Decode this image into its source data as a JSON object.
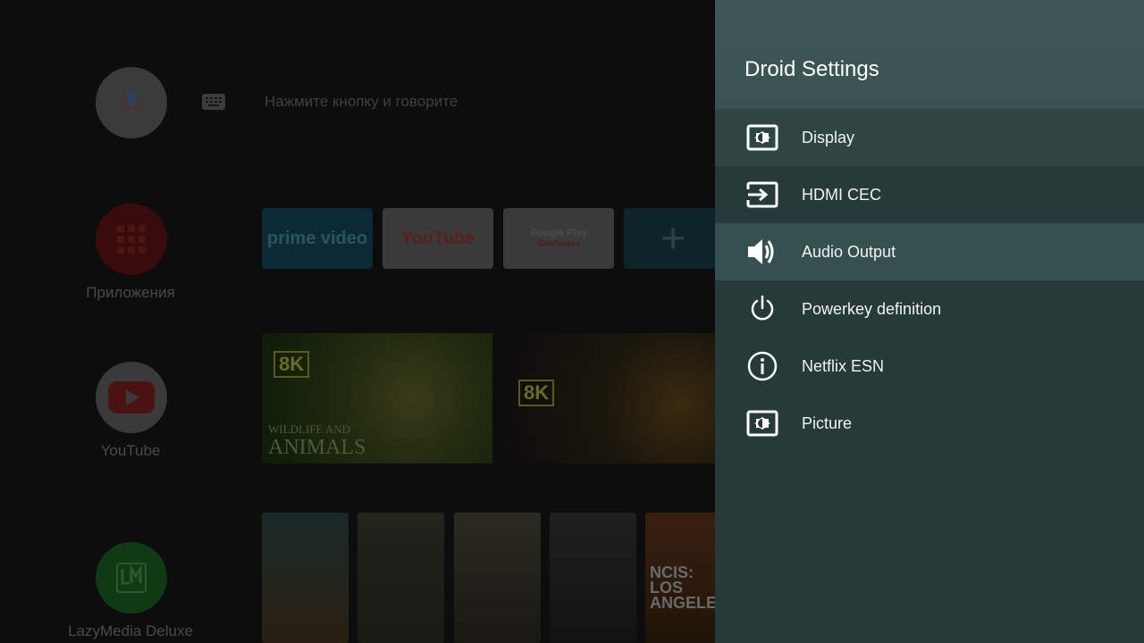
{
  "launcher": {
    "search_hint": "Нажмите кнопку и говорите",
    "rail": {
      "apps_label": "Приложения",
      "youtube_label": "YouTube",
      "lazymedia_label": "LazyMedia Deluxe"
    },
    "favorite_apps": [
      {
        "name": "prime video"
      },
      {
        "name": "YouTube"
      },
      {
        "name": "Google Play",
        "sub": "Фильмы"
      },
      {
        "name": "+"
      }
    ],
    "banners": [
      {
        "badge": "8K",
        "title_small": "WILDLIFE AND",
        "title_big": "ANIMALS"
      },
      {
        "badge": "8K"
      }
    ],
    "posters": [
      {
        "text": "NCIS: LOS ANGELES"
      }
    ]
  },
  "panel": {
    "title": "Droid Settings",
    "items": [
      {
        "label": "Display",
        "icon": "display-icon"
      },
      {
        "label": "HDMI CEC",
        "icon": "input-icon"
      },
      {
        "label": "Audio Output",
        "icon": "speaker-icon"
      },
      {
        "label": "Powerkey definition",
        "icon": "power-icon"
      },
      {
        "label": "Netflix ESN",
        "icon": "info-icon"
      },
      {
        "label": "Picture",
        "icon": "display-icon"
      }
    ],
    "focused_index": 2
  },
  "colors": {
    "panel_bg": "#263a39",
    "panel_header": "#3f5756",
    "focus_bg": "#36504f"
  }
}
